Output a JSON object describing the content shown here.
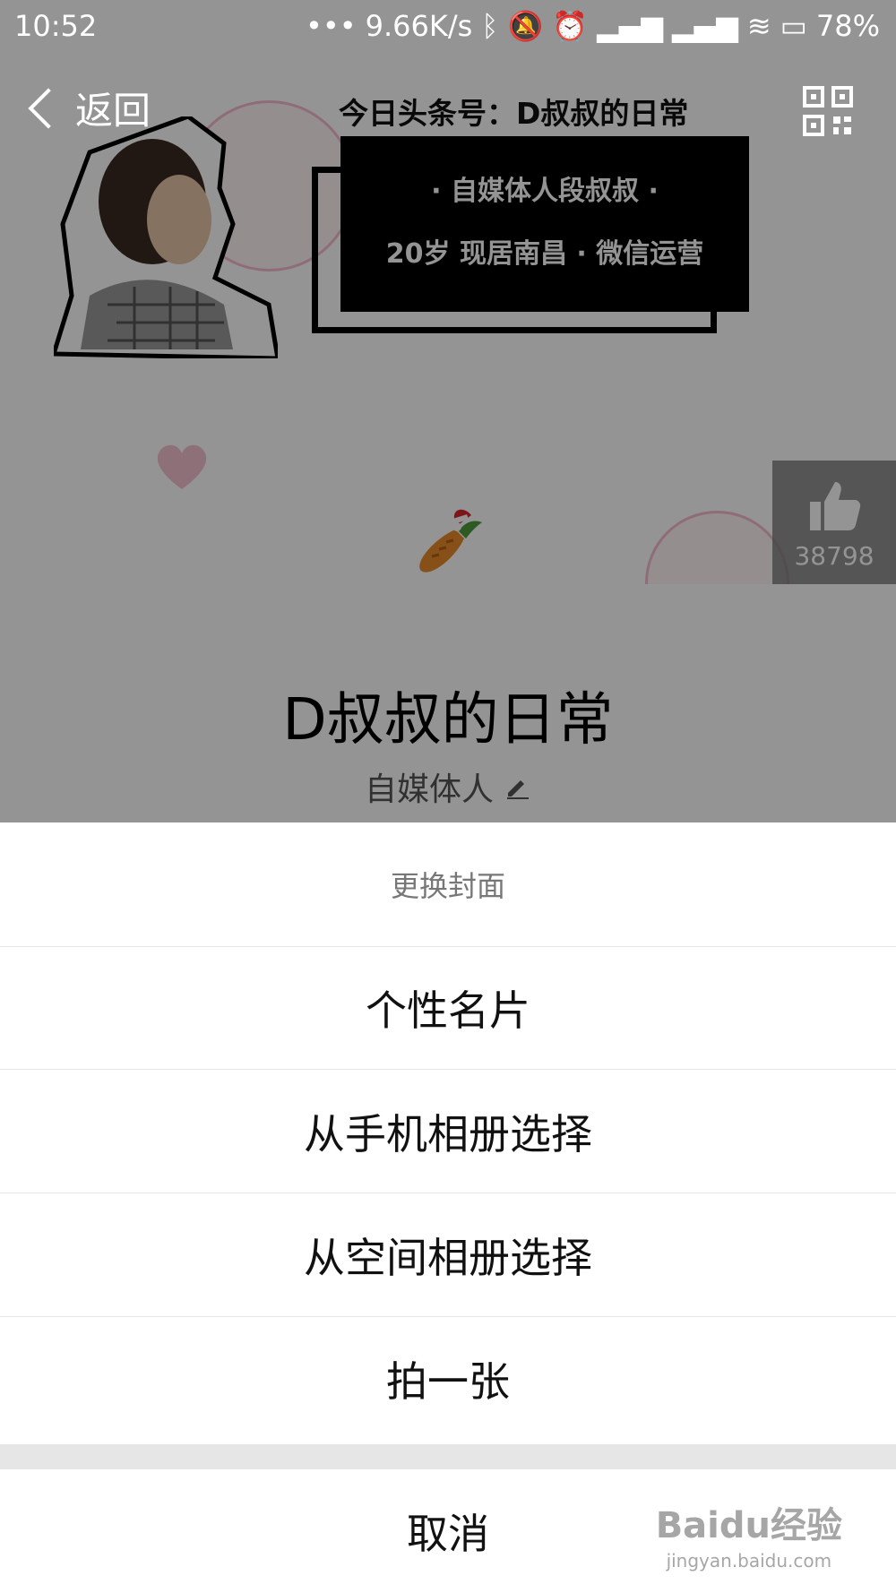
{
  "status": {
    "time": "10:52",
    "speed": "9.66K/s",
    "battery": "78%"
  },
  "header": {
    "back_label": "返回"
  },
  "cover": {
    "title": "今日头条号：D叔叔的日常",
    "intro_line1": "· 自媒体人段叔叔 ·",
    "intro_line2": "20岁  现居南昌 · 微信运营"
  },
  "like": {
    "count": "38798"
  },
  "profile": {
    "name": "D叔叔的日常",
    "tagline": "自媒体人"
  },
  "sheet": {
    "title": "更换封面",
    "options": [
      "个性名片",
      "从手机相册选择",
      "从空间相册选择",
      "拍一张"
    ],
    "cancel": "取消"
  },
  "watermark": {
    "brand": "Baidu经验",
    "url": "jingyan.baidu.com"
  },
  "colors": {
    "overlay": "#000000",
    "sheet_bg": "#ffffff",
    "divider": "#e6e6e6"
  }
}
